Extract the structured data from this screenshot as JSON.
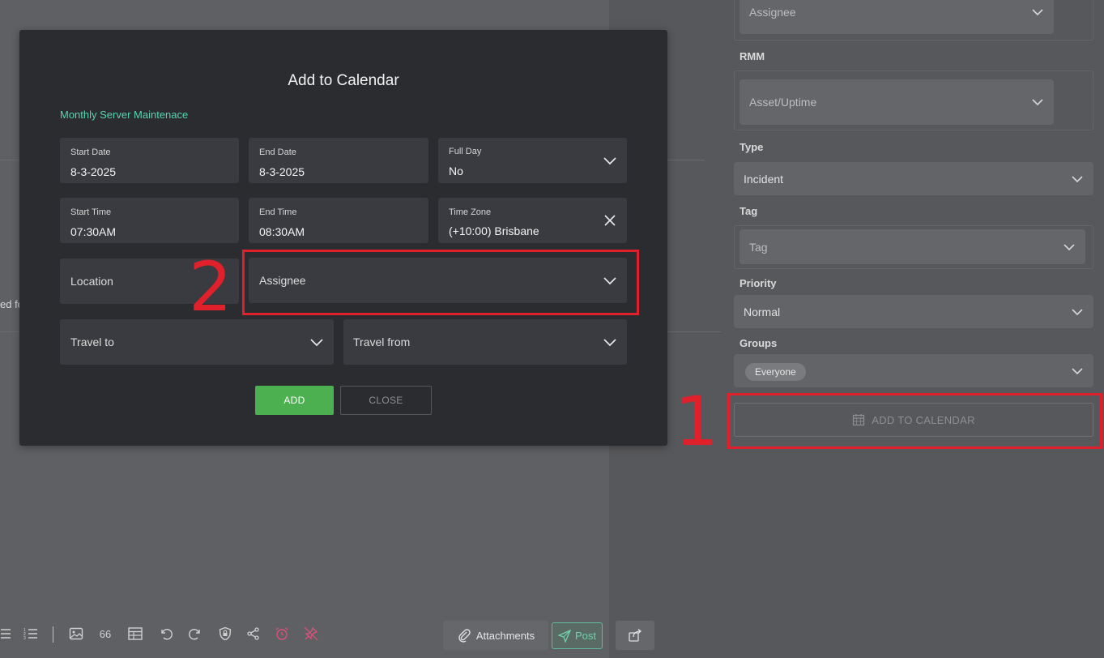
{
  "background": {
    "cut_text": "ed fo"
  },
  "right_panel": {
    "assignee_placeholder": "Assignee",
    "rmm_label": "RMM",
    "rmm_placeholder": "Asset/Uptime",
    "type_label": "Type",
    "type_value": "Incident",
    "tag_label": "Tag",
    "tag_placeholder": "Tag",
    "priority_label": "Priority",
    "priority_value": "Normal",
    "groups_label": "Groups",
    "groups_chip": "Everyone",
    "add_to_calendar_label": "ADD TO CALENDAR"
  },
  "callouts": {
    "one": "1",
    "two": "2"
  },
  "toolbar": {
    "quote_label": "66",
    "attachments_label": "Attachments",
    "post_label": "Post"
  },
  "modal": {
    "title": "Add to Calendar",
    "subtitle": "Monthly Server Maintenace",
    "start_date_label": "Start Date",
    "start_date_value": "8-3-2025",
    "end_date_label": "End Date",
    "end_date_value": "8-3-2025",
    "full_day_label": "Full Day",
    "full_day_value": "No",
    "start_time_label": "Start Time",
    "start_time_value": "07:30AM",
    "end_time_label": "End Time",
    "end_time_value": "08:30AM",
    "time_zone_label": "Time Zone",
    "time_zone_value": "(+10:00) Brisbane",
    "location_placeholder": "Location",
    "assignee_placeholder": "Assignee",
    "travel_to_placeholder": "Travel to",
    "travel_from_placeholder": "Travel from",
    "add_button": "ADD",
    "close_button": "CLOSE"
  },
  "colors": {
    "accent_green": "#4caf50",
    "teal_text": "#58d3b0",
    "annotation_red": "#e0202a",
    "modal_bg": "#2b2c2f"
  }
}
